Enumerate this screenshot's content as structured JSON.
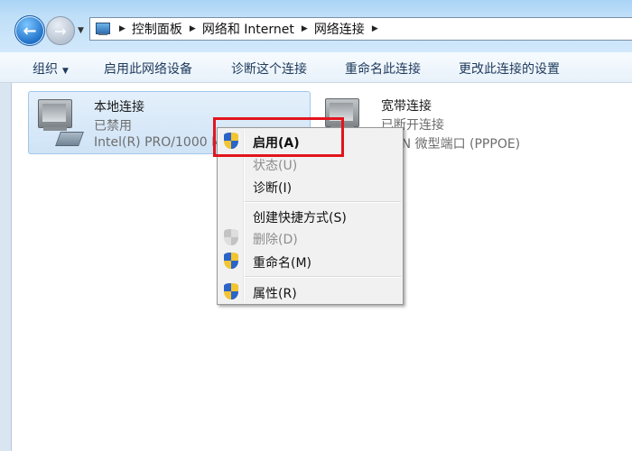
{
  "address": {
    "crumbs": [
      "控制面板",
      "网络和 Internet",
      "网络连接"
    ]
  },
  "toolbar": {
    "organize": "组织",
    "enable_device": "启用此网络设备",
    "diagnose": "诊断这个连接",
    "rename": "重命名此连接",
    "change_settings": "更改此连接的设置"
  },
  "connections": [
    {
      "name": "本地连接",
      "status": "已禁用",
      "device": "Intel(R) PRO/1000 M",
      "selected": true
    },
    {
      "name": "宽带连接",
      "status": "已断开连接",
      "device": "WAN 微型端口 (PPPOE)",
      "selected": false
    }
  ],
  "context_menu": {
    "items": [
      {
        "label": "启用(A)",
        "icon": "uac-shield-icon",
        "bold": true,
        "enabled": true
      },
      {
        "label": "状态(U)",
        "enabled": false
      },
      {
        "label": "诊断(I)",
        "enabled": true
      },
      {
        "label": "创建快捷方式(S)",
        "enabled": true
      },
      {
        "label": "删除(D)",
        "icon": "uac-shield-icon",
        "enabled": false
      },
      {
        "label": "重命名(M)",
        "icon": "uac-shield-icon",
        "enabled": true
      },
      {
        "label": "属性(R)",
        "icon": "uac-shield-icon",
        "enabled": true
      }
    ]
  },
  "colors": {
    "highlight_border": "#e2141e",
    "selection_background": "#cfe3f6"
  }
}
